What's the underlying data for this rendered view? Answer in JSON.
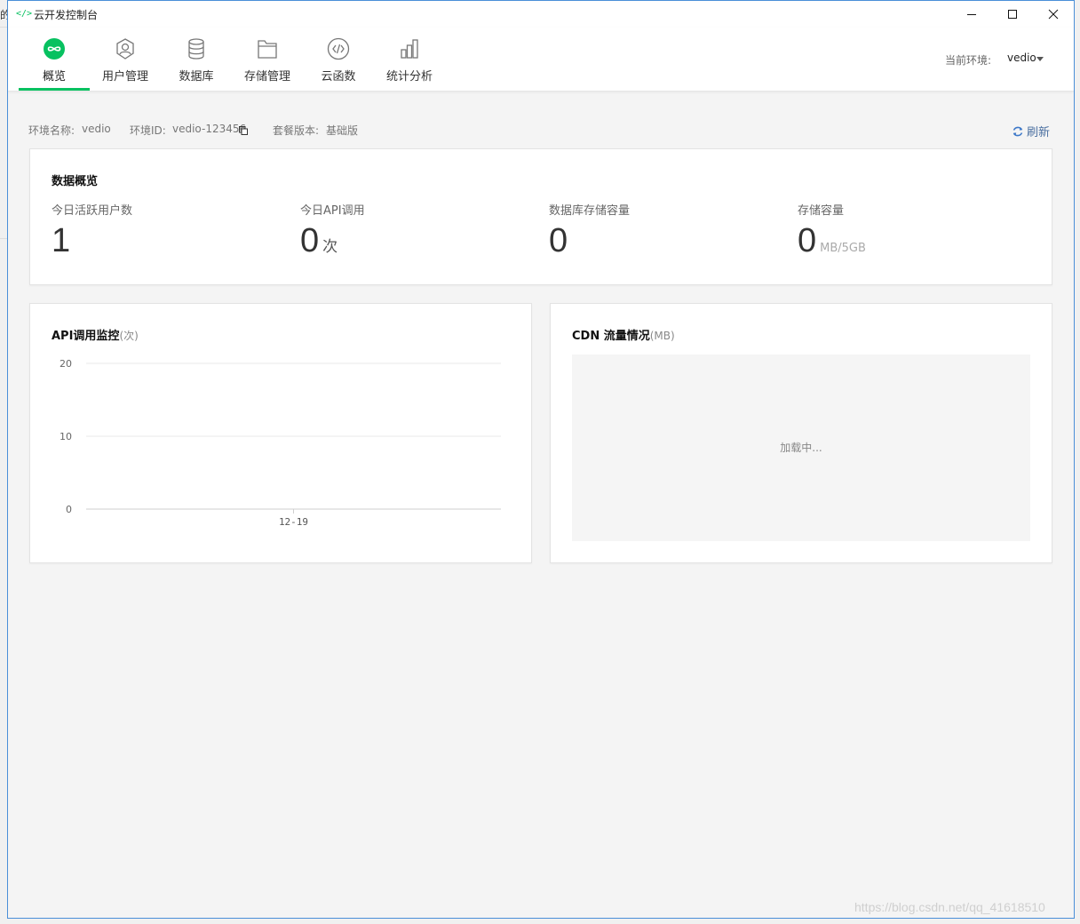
{
  "background": {
    "fragment": "的"
  },
  "window": {
    "title": "云开发控制台",
    "app_icon": "</>"
  },
  "nav": {
    "tabs": [
      {
        "label": "概览",
        "icon": "infinity-icon",
        "active": true
      },
      {
        "label": "用户管理",
        "icon": "user-icon",
        "active": false
      },
      {
        "label": "数据库",
        "icon": "database-icon",
        "active": false
      },
      {
        "label": "存储管理",
        "icon": "folder-icon",
        "active": false
      },
      {
        "label": "云函数",
        "icon": "code-icon",
        "active": false
      },
      {
        "label": "统计分析",
        "icon": "chart-icon",
        "active": false
      }
    ],
    "env_label": "当前环境:",
    "env_value": "vedio"
  },
  "info": {
    "env_name_label": "环境名称:",
    "env_name_value": "vedio",
    "env_id_label": "环境ID:",
    "env_id_value": "vedio-123456",
    "plan_label": "套餐版本:",
    "plan_value": "基础版",
    "refresh_label": "刷新"
  },
  "overview": {
    "title": "数据概览",
    "stats": [
      {
        "label": "今日活跃用户数",
        "value": "1",
        "unit": ""
      },
      {
        "label": "今日API调用",
        "value": "0",
        "unit": "次"
      },
      {
        "label": "数据库存储容量",
        "value": "0",
        "unit": ""
      },
      {
        "label": "存储容量",
        "value": "0",
        "unit": "MB/5GB"
      }
    ]
  },
  "api_card": {
    "title": "API调用监控",
    "unit": "(次)"
  },
  "cdn_card": {
    "title": "CDN 流量情况",
    "unit": "(MB)",
    "loading": "加载中..."
  },
  "chart_data": {
    "type": "line",
    "x": [
      "12-19"
    ],
    "series": [
      {
        "values": [
          0
        ]
      }
    ],
    "yticks": [
      0,
      10,
      20
    ],
    "ylim": [
      0,
      20
    ],
    "grid": true
  },
  "watermark": "https://blog.csdn.net/qq_41618510",
  "colors": {
    "accent": "#07c160",
    "window_border": "#4a8fd8"
  }
}
